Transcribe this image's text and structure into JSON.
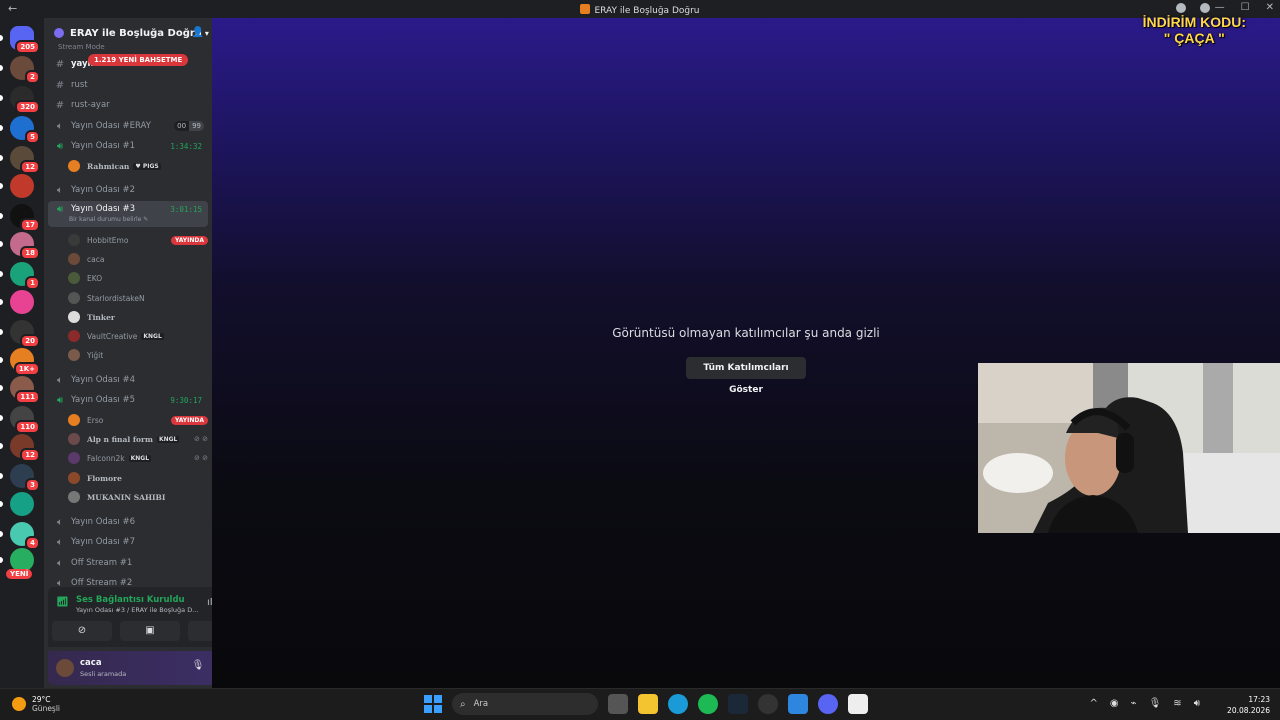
{
  "window": {
    "title": "ERAY ile Boşluğa Doğru"
  },
  "promo": {
    "line1": "İNDİRİM KODU:",
    "line2": "\" ÇAÇA \""
  },
  "guilds": [
    {
      "badge": "205",
      "color": "#5865f2"
    },
    {
      "badge": "2",
      "color": "#6a4b3b"
    },
    {
      "badge": "320",
      "color": "#2b2b2b"
    },
    {
      "badge": "5",
      "color": "#1f6fd1"
    },
    {
      "badge": "12",
      "color": "#5a4a3a"
    },
    {
      "badge": "",
      "color": "#c0392b"
    },
    {
      "badge": "17",
      "color": "#111111"
    },
    {
      "badge": "18",
      "color": "#c46a8a"
    },
    {
      "badge": "1",
      "color": "#1aa37a"
    },
    {
      "badge": "",
      "color": "#e84393"
    },
    {
      "badge": "20",
      "color": "#333333"
    },
    {
      "badge": "1K+",
      "color": "#e67e22"
    },
    {
      "badge": "111",
      "color": "#8a5a4a"
    },
    {
      "badge": "110",
      "color": "#444444"
    },
    {
      "badge": "12",
      "color": "#7a3a2a"
    },
    {
      "badge": "3",
      "color": "#2c3e50"
    },
    {
      "badge": "",
      "color": "#16a085"
    },
    {
      "badge": "4",
      "color": "#48c9b0"
    },
    {
      "badge": "",
      "color": "#27ae60"
    }
  ],
  "guild_new": "YENİ",
  "server": {
    "name": "ERAY ile Boşluğa Doğru",
    "stream_mode": "Stream Mode",
    "mention_pill": "1.219 YENİ BAHSETME"
  },
  "channels": {
    "c0": {
      "name": "yayın"
    },
    "c1": {
      "name": "rust"
    },
    "c2": {
      "name": "rust-ayar"
    },
    "c3": {
      "name": "Yayın Odası #ERAY",
      "count_a": "00",
      "count_b": "99"
    },
    "c4": {
      "name": "Yayın Odası #1",
      "timer": "1:34:32"
    },
    "c5": {
      "name": "Yayın Odası #2"
    },
    "c6": {
      "name": "Yayın Odası #3",
      "timer": "3:01:15",
      "status": "Bir kanal durumu belirle ✎"
    },
    "c7": {
      "name": "Yayın Odası #4"
    },
    "c8": {
      "name": "Yayın Odası #5",
      "timer": "9:30:17"
    },
    "c9": {
      "name": "Yayın Odası #6"
    },
    "c10": {
      "name": "Yayın Odası #7"
    },
    "c11": {
      "name": "Off Stream #1"
    },
    "c12": {
      "name": "Off Stream #2"
    }
  },
  "users": {
    "u0": {
      "name": "Rahmican",
      "tag": "♥ PIGS"
    },
    "u1": {
      "name": "HobbitEmo",
      "live": "YAYINDA"
    },
    "u2": {
      "name": "caca"
    },
    "u3": {
      "name": "EKO"
    },
    "u4": {
      "name": "StarlordistakeN"
    },
    "u5": {
      "name": "Tinker"
    },
    "u6": {
      "name": "VaultCreative",
      "tag": "KNGL"
    },
    "u7": {
      "name": "Yiğit"
    },
    "u8": {
      "name": "Erso",
      "live": "YAYINDA"
    },
    "u9": {
      "name": "Alp n final form",
      "tag": "KNGL"
    },
    "u10": {
      "name": "Falconn2k",
      "tag": "KNGL"
    },
    "u11": {
      "name": "Flomore"
    },
    "u12": {
      "name": "MUKANIN SAHIBI"
    }
  },
  "voice": {
    "status": "Ses Bağlantısı Kuruldu",
    "sub": "Yayın Odası #3 / ERAY ile Boşluğa D..."
  },
  "me": {
    "name": "caca",
    "sub": "Sesli aramada"
  },
  "stage": {
    "message": "Görüntüsü olmayan katılımcılar şu anda gizli",
    "button": "Tüm Katılımcıları Göster"
  },
  "taskbar": {
    "temp": "29°C",
    "weather": "Güneşli",
    "search": "Ara",
    "time": "17:23",
    "date": "20.08.2026"
  }
}
